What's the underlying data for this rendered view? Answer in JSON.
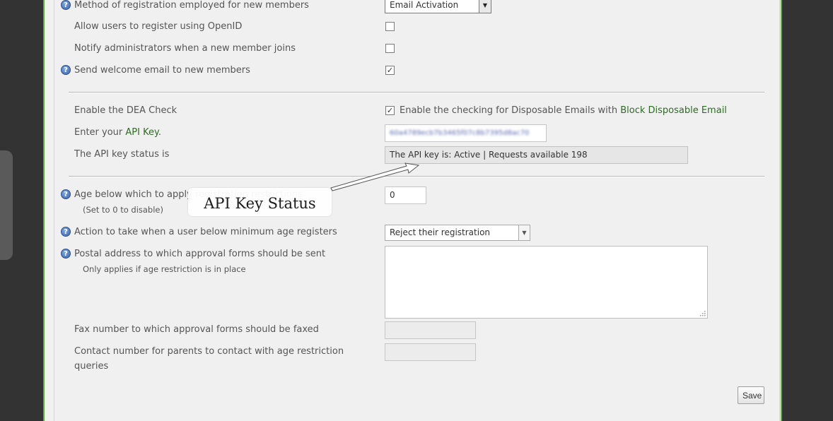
{
  "settings": {
    "registration_method": {
      "label": "Method of registration employed for new members",
      "value": "Email Activation"
    },
    "openid": {
      "label": "Allow users to register using OpenID",
      "checked": false
    },
    "notify_admins": {
      "label": "Notify administrators when a new member joins",
      "checked": false
    },
    "welcome_email": {
      "label": "Send welcome email to new members",
      "checked": true
    }
  },
  "dea": {
    "enable_label": "Enable the DEA Check",
    "checkbox_text": "Enable the checking for Disposable Emails with",
    "checkbox_link": "Block Disposable Email",
    "checked": true,
    "api_key_label_prefix": "Enter your",
    "api_key_label_link": "API Key",
    "api_key_label_suffix": ".",
    "api_key_value": "60a4789ecb7b3465f07c8b7395d8ac70",
    "status_label": "The API key status is",
    "status_value": "The API key is: Active | Requests available 198"
  },
  "callout": {
    "text": "API Key Status"
  },
  "age": {
    "age_label": "Age below which to apply registration restrictions",
    "age_hint": "(Set to 0 to disable)",
    "age_value": "0",
    "action_label": "Action to take when a user below minimum age registers",
    "action_value": "Reject their registration",
    "postal_label": "Postal address to which approval forms should be sent",
    "postal_hint": "Only applies if age restriction is in place",
    "fax_label": "Fax number to which approval forms should be faxed",
    "contact_label_line1": "Contact number for parents to contact with age restriction",
    "contact_label_line2": "queries"
  },
  "buttons": {
    "save": "Save"
  },
  "icons": {
    "help": "help-icon",
    "check": "check-icon"
  },
  "colors": {
    "accent": "#5cac3e",
    "link": "#2d6b23",
    "background": "#333333"
  }
}
